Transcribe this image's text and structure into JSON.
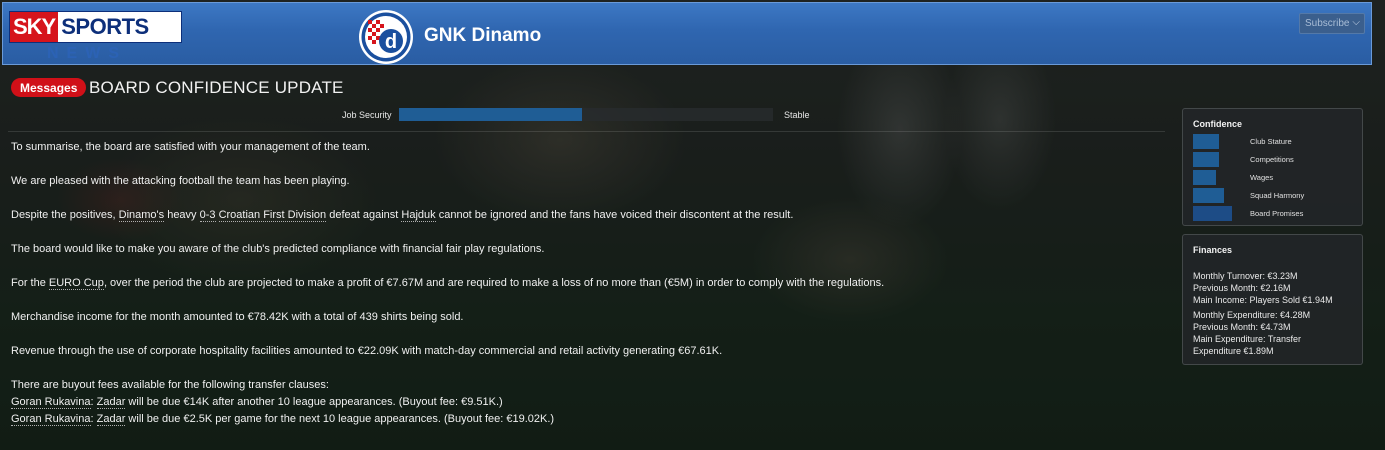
{
  "header": {
    "logo_sky": "SKY",
    "logo_sports": "SPORTS",
    "logo_news": "NEWS",
    "club_name": "GNK Dinamo",
    "subscribe_label": "Subscribe"
  },
  "message": {
    "badge": "Messages",
    "title": "BOARD CONFIDENCE UPDATE"
  },
  "job_security": {
    "label": "Job Security",
    "status": "Stable",
    "level_percent": 49
  },
  "paragraphs": [
    [
      {
        "t": "To summarise, the board are satisfied with your management of the team."
      }
    ],
    [
      {
        "t": "We are pleased with the attacking football the team has been playing."
      }
    ],
    [
      {
        "t": "Despite the positives, "
      },
      {
        "t": "Dinamo's",
        "link": true
      },
      {
        "t": " heavy "
      },
      {
        "t": "0-3",
        "link": true
      },
      {
        "t": " "
      },
      {
        "t": "Croatian First Division",
        "link": true
      },
      {
        "t": " defeat against "
      },
      {
        "t": "Hajduk",
        "link": true
      },
      {
        "t": " cannot be ignored and the fans have voiced their discontent at the result."
      }
    ],
    [
      {
        "t": "The board would like to make you aware of the club's predicted compliance with financial fair play regulations."
      }
    ],
    [
      {
        "t": "For the "
      },
      {
        "t": "EURO Cup",
        "link": true
      },
      {
        "t": ", over the period the club are projected to make a profit of €7.67M and are required to make a loss of no more than (€5M) in order to comply with the regulations."
      }
    ],
    [
      {
        "t": "Merchandise income for the month amounted to €78.42K with a total of 439 shirts being sold."
      }
    ],
    [
      {
        "t": "Revenue through the use of corporate hospitality facilities amounted to €22.09K with match-day commercial and retail activity generating €67.61K."
      }
    ],
    [
      {
        "t": "There are buyout fees available for the following transfer clauses:"
      }
    ],
    [
      {
        "t": "Goran Rukavina",
        "link": true
      },
      {
        "t": ": "
      },
      {
        "t": "Zadar",
        "link": true
      },
      {
        "t": " will be due €14K after another 10 league appearances. (Buyout fee: €9.51K.)"
      }
    ],
    [
      {
        "t": "Goran Rukavina",
        "link": true
      },
      {
        "t": ": "
      },
      {
        "t": "Zadar",
        "link": true
      },
      {
        "t": " will be due €2.5K per game for the next 10 league appearances. (Buyout fee: €19.02K.)"
      }
    ]
  ],
  "confidence": {
    "title": "Confidence",
    "items": [
      {
        "label": "Club Stature",
        "level": 0.5
      },
      {
        "label": "Competitions",
        "level": 0.5
      },
      {
        "label": "Wages",
        "level": 0.45
      },
      {
        "label": "Squad Harmony",
        "level": 0.6
      },
      {
        "label": "Board Promises",
        "level": 0.75
      }
    ]
  },
  "finances": {
    "title": "Finances",
    "lines": [
      "Monthly Turnover: €3.23M",
      "Previous Month: €2.16M",
      "Main Income: Players Sold €1.94M",
      "Monthly Expenditure: €4.28M",
      "Previous Month: €4.73M",
      "Main Expenditure: Transfer",
      "Expenditure €1.89M"
    ]
  },
  "colors": {
    "header_blue": "#2f66b0",
    "bar_blue": "#1f5d95",
    "badge_red": "#d01018"
  }
}
